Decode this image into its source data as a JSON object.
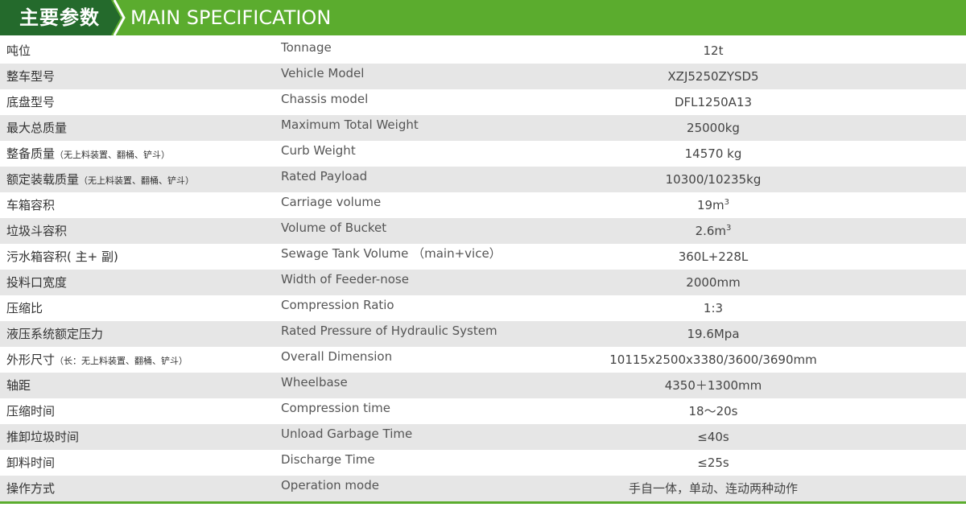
{
  "header": {
    "title_cn": "主要参数",
    "title_en": "MAIN SPECIFICATION"
  },
  "colors": {
    "header_green": "#5bac2e",
    "header_dark_green": "#246a2c",
    "row_stripe": "#e6e6e6"
  },
  "rows": [
    {
      "cn": "吨位",
      "cn_note": "",
      "en": "Tonnage",
      "value": "12t",
      "sup": ""
    },
    {
      "cn": "整车型号",
      "cn_note": "",
      "en": "Vehicle Model",
      "value": "XZJ5250ZYSD5",
      "sup": ""
    },
    {
      "cn": "底盘型号",
      "cn_note": "",
      "en": "Chassis model",
      "value": "DFL1250A13",
      "sup": ""
    },
    {
      "cn": "最大总质量",
      "cn_note": "",
      "en": "Maximum Total Weight",
      "value": "25000kg",
      "sup": ""
    },
    {
      "cn": "整备质量",
      "cn_note": "（无上料装置、翻桶、铲斗）",
      "en": "Curb Weight",
      "value": "14570 kg",
      "sup": ""
    },
    {
      "cn": "额定装载质量",
      "cn_note": "（无上料装置、翻桶、铲斗）",
      "en": "Rated Payload",
      "value": "10300/10235kg",
      "sup": ""
    },
    {
      "cn": "车箱容积",
      "cn_note": "",
      "en": "Carriage volume",
      "value": "19m",
      "sup": "3"
    },
    {
      "cn": "垃圾斗容积",
      "cn_note": "",
      "en": "Volume of  Bucket",
      "value": "2.6m",
      "sup": "3"
    },
    {
      "cn": "污水箱容积( 主+ 副)",
      "cn_note": "",
      "en": "Sewage Tank Volume （main+vice）",
      "value": "360L+228L",
      "sup": ""
    },
    {
      "cn": "投料口宽度",
      "cn_note": "",
      "en": "Width of  Feeder-nose",
      "value": "2000mm",
      "sup": ""
    },
    {
      "cn": "压缩比",
      "cn_note": "",
      "en": "Compression Ratio",
      "value": "1:3",
      "sup": ""
    },
    {
      "cn": "液压系统额定压力",
      "cn_note": "",
      "en": "Rated Pressure of Hydraulic System",
      "value": "19.6Mpa",
      "sup": ""
    },
    {
      "cn": "外形尺寸",
      "cn_note": "（长：无上料装置、翻桶、铲斗）",
      "en": "Overall Dimension",
      "value": "10115x2500x3380/3600/3690mm",
      "sup": ""
    },
    {
      "cn": "轴距",
      "cn_note": "",
      "en": "Wheelbase",
      "value": "4350＋1300mm",
      "sup": ""
    },
    {
      "cn": "压缩时间",
      "cn_note": "",
      "en": "Compression time",
      "value": "18～20s",
      "sup": ""
    },
    {
      "cn": "推卸垃圾时间",
      "cn_note": "",
      "en": "Unload Garbage Time",
      "value": "≤40s",
      "sup": ""
    },
    {
      "cn": "卸料时间",
      "cn_note": "",
      "en": "Discharge Time",
      "value": "≤25s",
      "sup": ""
    },
    {
      "cn": "操作方式",
      "cn_note": "",
      "en": "Operation mode",
      "value": "手自一体，单动、连动两种动作",
      "sup": ""
    }
  ]
}
